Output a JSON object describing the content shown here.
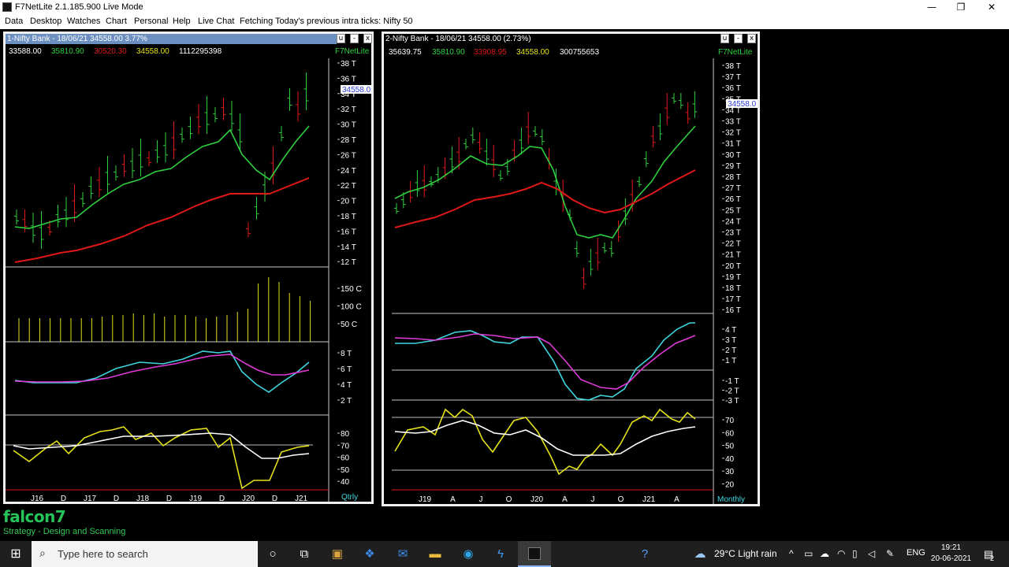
{
  "window": {
    "title": "F7NetLite 2.1.185.900 Live Mode",
    "minimize": "—",
    "maximize": "❐",
    "close": "✕"
  },
  "menu": [
    "Data",
    "Desktop",
    "Watches",
    "Chart",
    "Personal",
    "Help",
    "Live Chat",
    "Fetching Today's previous intra ticks: Nifty 50"
  ],
  "chart1": {
    "title": "1-Nifty Bank - 18/06/21 34558.00 3.77%",
    "controls": [
      "u",
      "-",
      "x"
    ],
    "ohlc": [
      "33588.00",
      "35810.90",
      "30520.30",
      "34558.00",
      "1112295398"
    ],
    "brand": "F7NetLite",
    "price_ticks": [
      "38 T",
      "36 T",
      "34 T",
      "32 T",
      "30 T",
      "28 T",
      "26 T",
      "24 T",
      "22 T",
      "20 T",
      "18 T",
      "16 T",
      "14 T",
      "12 T"
    ],
    "price_label": "34558.0",
    "volume_ticks": [
      "150 C",
      "100 C",
      "50 C"
    ],
    "macd_ticks": [
      "8 T",
      "6 T",
      "4 T",
      "2 T"
    ],
    "rsi_ticks": [
      "80",
      "70",
      "60",
      "50",
      "40"
    ],
    "time_labels": [
      "J16",
      "D",
      "J17",
      "D",
      "J18",
      "D",
      "J19",
      "D",
      "J20",
      "D",
      "J21"
    ],
    "period": "Qtrly"
  },
  "chart2": {
    "title": "2-Nifty Bank - 18/06/21 34558.00 (2.73%)",
    "controls": [
      "u",
      "-",
      "x"
    ],
    "ohlc": [
      "35639.75",
      "35810.90",
      "33908.95",
      "34558.00",
      "300755653"
    ],
    "brand": "F7NetLite",
    "price_ticks": [
      "38 T",
      "37 T",
      "36 T",
      "35 T",
      "34 T",
      "33 T",
      "32 T",
      "31 T",
      "30 T",
      "29 T",
      "28 T",
      "27 T",
      "26 T",
      "25 T",
      "24 T",
      "23 T",
      "22 T",
      "21 T",
      "20 T",
      "19 T",
      "18 T",
      "17 T",
      "16 T"
    ],
    "price_label": "34558.0",
    "macd_ticks": [
      "4 T",
      "3 T",
      "2 T",
      "1 T",
      "-1 T",
      "-2 T",
      "-3 T"
    ],
    "rsi_ticks": [
      "70",
      "60",
      "50",
      "40",
      "30",
      "20"
    ],
    "time_labels": [
      "J19",
      "A",
      "J",
      "O",
      "J20",
      "A",
      "J",
      "O",
      "J21",
      "A"
    ],
    "period": "Monthly"
  },
  "footer": {
    "logo": "falcon7",
    "slogan": "Strategy - Design and Scanning"
  },
  "taskbar": {
    "search_placeholder": "Type here to search",
    "weather": "29°C  Light rain",
    "language": "ENG",
    "time": "19:21",
    "date": "20-06-2021",
    "notifications": "2"
  },
  "colors": {
    "green": "#2fcf3f",
    "red": "#e01818",
    "yellow": "#e6e21a",
    "cyan": "#3fd6df",
    "magenta": "#e03ad8",
    "white": "#ffffff"
  }
}
